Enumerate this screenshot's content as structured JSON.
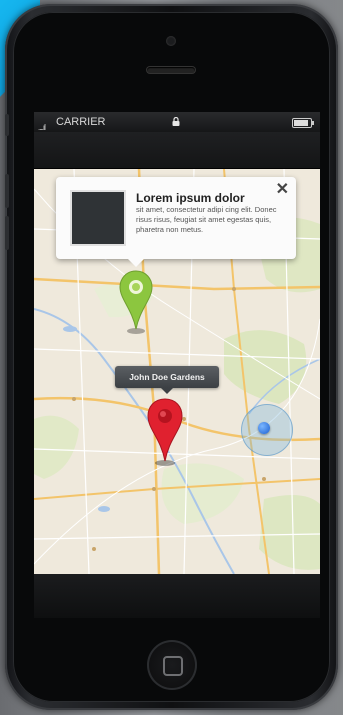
{
  "status_bar": {
    "carrier": "CARRIER",
    "signal_bars": "....ıl",
    "battery_level": 0.85
  },
  "callout": {
    "title": "Lorem ipsum dolor",
    "body": "sit amet, consectetur adipi cing elit. Donec risus risus, feugiat sit amet egestas quis, pharetra non metus.",
    "close_icon": "✕"
  },
  "pin_label": {
    "text": "John Doe Gardens"
  },
  "colors": {
    "green_pin": "#8cc63f",
    "red_pin": "#e0212f",
    "location_dot": "#1b5fd1",
    "background_accent": "#16b7f0"
  },
  "icons": {
    "lock": "lock-icon",
    "battery": "battery-icon",
    "close": "close-icon",
    "home": "home-button"
  }
}
